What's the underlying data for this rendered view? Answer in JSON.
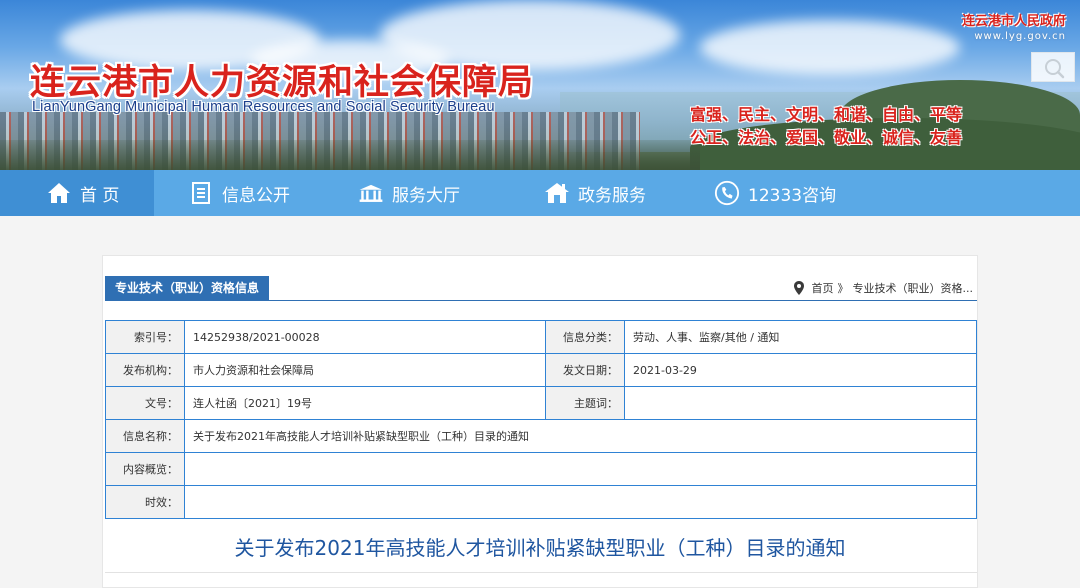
{
  "header": {
    "title": "连云港市人力资源和社会保障局",
    "subtitle": "LianYunGang Municipal Human Resources and Social Security Bureau",
    "gov_name": "连云港市人民政府",
    "gov_url": "www.lyg.gov.cn",
    "slogans": [
      "富强、民主、文明、和谐、自由、平等",
      "公正、法治、爱国、敬业、诚信、友善"
    ]
  },
  "nav": {
    "items": [
      {
        "label": "首 页",
        "icon": "home-icon"
      },
      {
        "label": "信息公开",
        "icon": "document-icon"
      },
      {
        "label": "服务大厅",
        "icon": "building-icon"
      },
      {
        "label": "政务服务",
        "icon": "house-icon"
      },
      {
        "label": "12333咨询",
        "icon": "phone-icon"
      }
    ]
  },
  "section": {
    "tab_label": "专业技术（职业）资格信息",
    "breadcrumb_home": "首页",
    "breadcrumb_sep": "》",
    "breadcrumb_current": "专业技术（职业）资格..."
  },
  "meta": {
    "index_no_label": "索引号：",
    "index_no": "14252938/2021-00028",
    "category_label": "信息分类：",
    "category": "劳动、人事、监察/其他 / 通知",
    "publisher_label": "发布机构：",
    "publisher": "市人力资源和社会保障局",
    "date_label": "发文日期：",
    "date": "2021-03-29",
    "doc_no_label": "文号：",
    "doc_no": "连人社函〔2021〕19号",
    "keywords_label": "主题词：",
    "keywords": "",
    "info_name_label": "信息名称：",
    "info_name": "关于发布2021年高技能人才培训补贴紧缺型职业（工种）目录的通知",
    "summary_label": "内容概览：",
    "summary": "",
    "validity_label": "时效：",
    "validity": ""
  },
  "article": {
    "title": "关于发布2021年高技能人才培训补贴紧缺型职业（工种）目录的通知"
  }
}
